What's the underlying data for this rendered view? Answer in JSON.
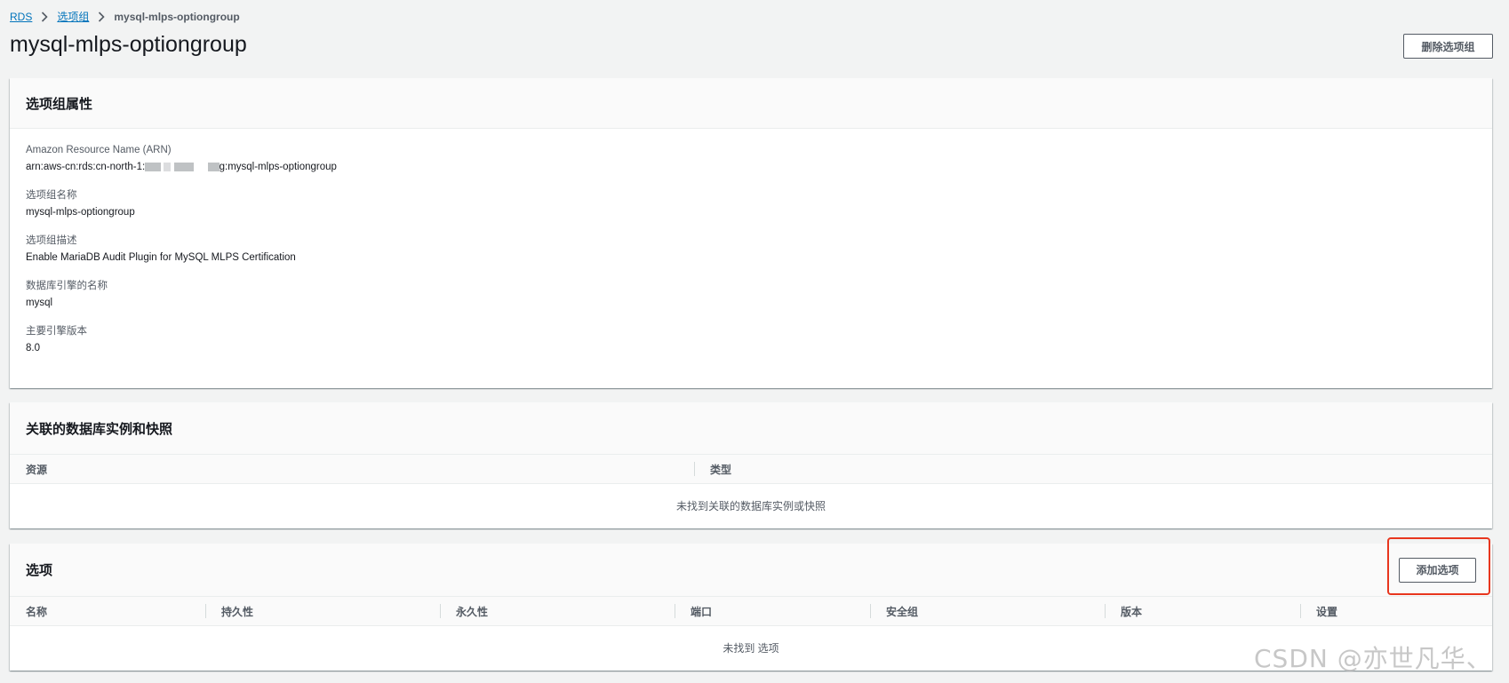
{
  "breadcrumb": {
    "items": [
      "RDS",
      "选项组"
    ],
    "current": "mysql-mlps-optiongroup"
  },
  "header": {
    "title": "mysql-mlps-optiongroup",
    "delete_label": "删除选项组"
  },
  "properties": {
    "title": "选项组属性",
    "arn_label": "Amazon Resource Name (ARN)",
    "arn_prefix": "arn:aws-cn:rds:cn-north-1:",
    "arn_suffix": "g:mysql-mlps-optiongroup",
    "name_label": "选项组名称",
    "name_value": "mysql-mlps-optiongroup",
    "desc_label": "选项组描述",
    "desc_value": "Enable MariaDB Audit Plugin for MySQL MLPS Certification",
    "engine_label": "数据库引擎的名称",
    "engine_value": "mysql",
    "version_label": "主要引擎版本",
    "version_value": "8.0"
  },
  "associations": {
    "title": "关联的数据库实例和快照",
    "columns": [
      "资源",
      "类型"
    ],
    "empty_text": "未找到关联的数据库实例或快照"
  },
  "options": {
    "title": "选项",
    "add_label": "添加选项",
    "columns": [
      "名称",
      "持久性",
      "永久性",
      "端口",
      "安全组",
      "版本",
      "设置"
    ],
    "empty_text": "未找到 选项"
  },
  "watermark": "CSDN @亦世凡华、",
  "colors": {
    "link": "#0073bb",
    "highlight": "#e8361e",
    "page_bg": "#f2f3f3"
  }
}
